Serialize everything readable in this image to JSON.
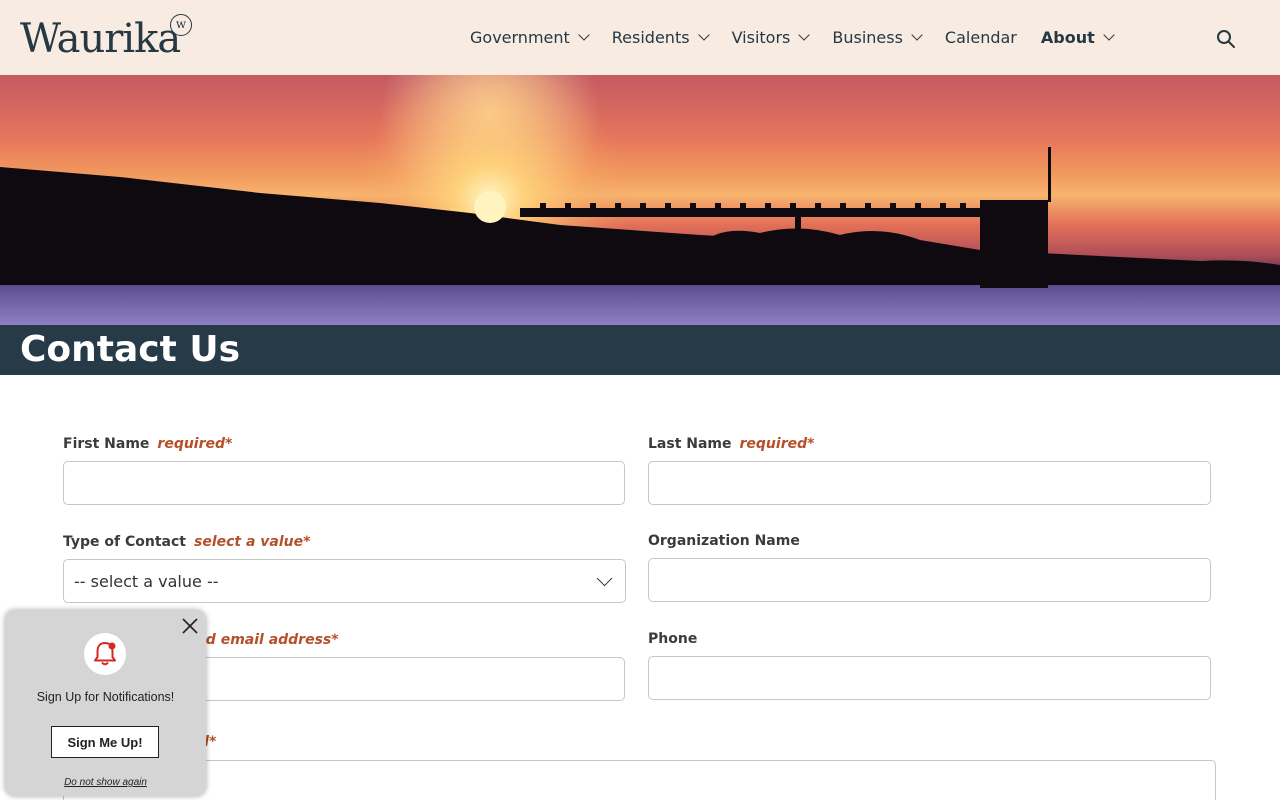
{
  "header": {
    "logo_text": "Waurika",
    "logo_badge": "w",
    "nav": [
      {
        "label": "Government"
      },
      {
        "label": "Residents"
      },
      {
        "label": "Visitors"
      },
      {
        "label": "Business"
      },
      {
        "label": "Calendar"
      },
      {
        "label": "About"
      }
    ]
  },
  "page": {
    "title": "Contact Us"
  },
  "form": {
    "first_name": {
      "label": "First Name",
      "required": "required*"
    },
    "last_name": {
      "label": "Last Name",
      "required": "required*"
    },
    "contact_type": {
      "label": "Type of Contact",
      "required": "select a value*",
      "selected": "-- select a value --"
    },
    "organization": {
      "label": "Organization Name"
    },
    "email": {
      "required_partial": "id email address*"
    },
    "phone": {
      "label": "Phone"
    },
    "message": {
      "required_partial": "d*"
    }
  },
  "popup": {
    "text": "Sign Up for Notifications!",
    "button": "Sign Me Up!",
    "link": "Do not show again"
  },
  "colors": {
    "header_bg": "#f8ece2",
    "title_band": "#263a47",
    "required": "#b5502a",
    "bell": "#d62828"
  }
}
